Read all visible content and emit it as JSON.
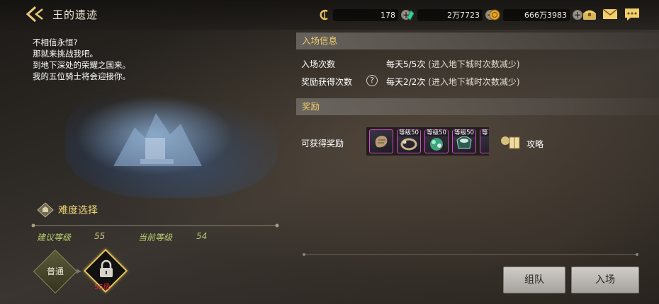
{
  "header": {
    "title": "王的遗迹",
    "currencies": [
      {
        "icon": "dungeon-coin-icon",
        "value": "178"
      },
      {
        "icon": "green-gem-icon",
        "value": "2万7723"
      },
      {
        "icon": "gold-coin-icon",
        "value": "666万3983"
      }
    ],
    "actions": [
      "treasure-chest-icon",
      "mail-icon",
      "chat-icon"
    ]
  },
  "story": {
    "lines": [
      "不相信永恒?",
      "那就来挑战我吧。",
      "到地下深处的荣耀之国来。",
      "我的五位骑士将会迎接你。"
    ]
  },
  "difficulty": {
    "title": "难度选择",
    "recommended_label": "建议等级",
    "recommended_value": "55",
    "current_label": "当前等级",
    "current_value": "54",
    "options": [
      {
        "label": "普通",
        "locked": false
      },
      {
        "label": "",
        "locked": true,
        "requirement": "55级"
      }
    ]
  },
  "entry_info": {
    "title": "入场信息",
    "rows": [
      {
        "label": "入场次数",
        "value": "每天5/5次",
        "note": " (进入地下城时次数减少)"
      },
      {
        "label": "奖励获得次数",
        "value": "每天2/2次",
        "note": " (进入地下城时次数减少)"
      }
    ]
  },
  "rewards": {
    "title": "奖励",
    "label": "可获得奖励",
    "items": [
      {
        "icon": "scroll-item-icon",
        "level": ""
      },
      {
        "icon": "bracelet-item-icon",
        "level": "等级50"
      },
      {
        "icon": "gem-cluster-item-icon",
        "level": "等级50"
      },
      {
        "icon": "armor-item-icon",
        "level": "等级50"
      },
      {
        "icon": "partial-item-icon",
        "level": "等"
      }
    ],
    "guide_label": "攻略"
  },
  "buttons": {
    "team": "组队",
    "enter": "入场"
  },
  "colors": {
    "section_title": "#f0cf6a",
    "level_label": "#b6cc6e",
    "locked_requirement": "#e03030",
    "item_border": "#d24bd0"
  }
}
